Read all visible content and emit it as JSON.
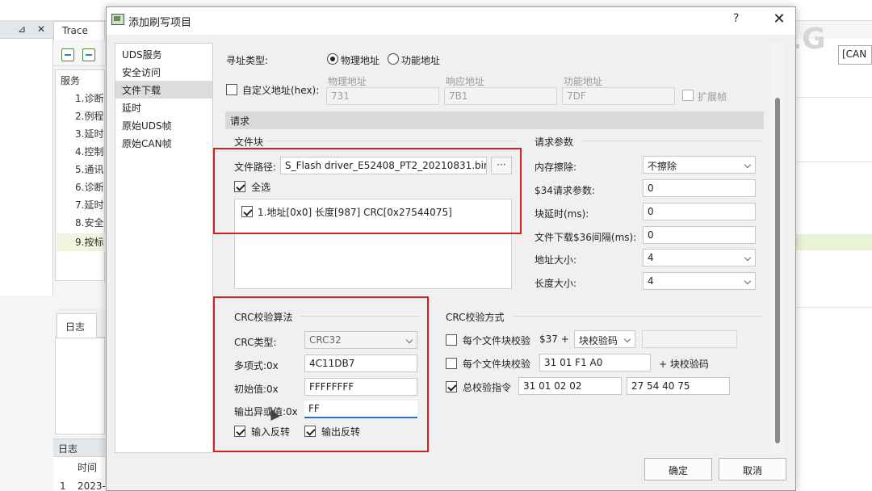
{
  "background_app": {
    "trace_tab": "Trace",
    "pin_icon": "⊿",
    "close_icon": "✕",
    "service_panel_title": "服务",
    "service_items": [
      "1.诊断",
      "2.例程",
      "3.延时",
      "4.控制",
      "5.通讯",
      "6.诊断",
      "7.延时",
      "8.安全",
      "9.按标"
    ],
    "log_tab": "日志",
    "bottom_bar": "日志",
    "table_header_time": "时间",
    "table_row_index": "1",
    "table_row_time": "2023-",
    "right_field": "[CAN"
  },
  "watermark": "ZLG",
  "dialog": {
    "title": "添加刷写项目",
    "help": "?",
    "close": "✕",
    "nav_items": [
      {
        "label": "UDS服务",
        "selected": false
      },
      {
        "label": "安全访问",
        "selected": false
      },
      {
        "label": "文件下载",
        "selected": true
      },
      {
        "label": "延时",
        "selected": false
      },
      {
        "label": "原始UDS帧",
        "selected": false
      },
      {
        "label": "原始CAN帧",
        "selected": false
      }
    ],
    "addressing": {
      "label": "寻址类型:",
      "physical": "物理地址",
      "functional": "功能地址",
      "selected": "physical"
    },
    "custom_address": {
      "label": "自定义地址(hex):",
      "checked": false,
      "physical_label": "物理地址",
      "physical_value": "731",
      "response_label": "响应地址",
      "response_value": "7B1",
      "functional_label": "功能地址",
      "functional_value": "7DF",
      "extended_label": "扩展帧",
      "extended_checked": false
    },
    "request_section": "请求",
    "file_block": {
      "title": "文件块",
      "path_label": "文件路径:",
      "path_value": "S_Flash driver_E52408_PT2_20210831.bin",
      "browse": "···",
      "select_all": "全选",
      "select_all_checked": true,
      "items": [
        {
          "label": "1.地址[0x0] 长度[987] CRC[0x27544075]",
          "checked": true
        }
      ]
    },
    "request_params": {
      "title": "请求参数",
      "memory_erase_label": "内存擦除:",
      "memory_erase_value": "不擦除",
      "param34_label": "$34请求参数:",
      "param34_value": "0",
      "block_delay_label": "块延时(ms):",
      "block_delay_value": "0",
      "interval36_label": "文件下载$36间隔(ms):",
      "interval36_value": "0",
      "addr_size_label": "地址大小:",
      "addr_size_value": "4",
      "len_size_label": "长度大小:",
      "len_size_value": "4"
    },
    "crc_algorithm": {
      "title": "CRC校验算法",
      "type_label": "CRC类型:",
      "type_value": "CRC32",
      "poly_label": "多项式:0x",
      "poly_value": "4C11DB7",
      "init_label": "初始值:0x",
      "init_value": "FFFFFFFF",
      "xorout_label": "输出异或值:0x",
      "xorout_value": "FF",
      "reflect_in_label": "输入反转",
      "reflect_in_checked": true,
      "reflect_out_label": "输出反转",
      "reflect_out_checked": true
    },
    "crc_method": {
      "title": "CRC校验方式",
      "row1_label": "每个文件块校验",
      "row1_checked": false,
      "row1_code": "$37 +",
      "row1_select": "块校验码",
      "row1_input": "",
      "row2_label": "每个文件块校验",
      "row2_checked": false,
      "row2_input": "31 01 F1 A0",
      "row2_suffix": "+ 块校验码",
      "row3_label": "总校验指令",
      "row3_checked": true,
      "row3_input1": "31 01 02 02",
      "row3_input2": "27 54 40 75"
    },
    "ok_button": "确定",
    "cancel_button": "取消"
  }
}
